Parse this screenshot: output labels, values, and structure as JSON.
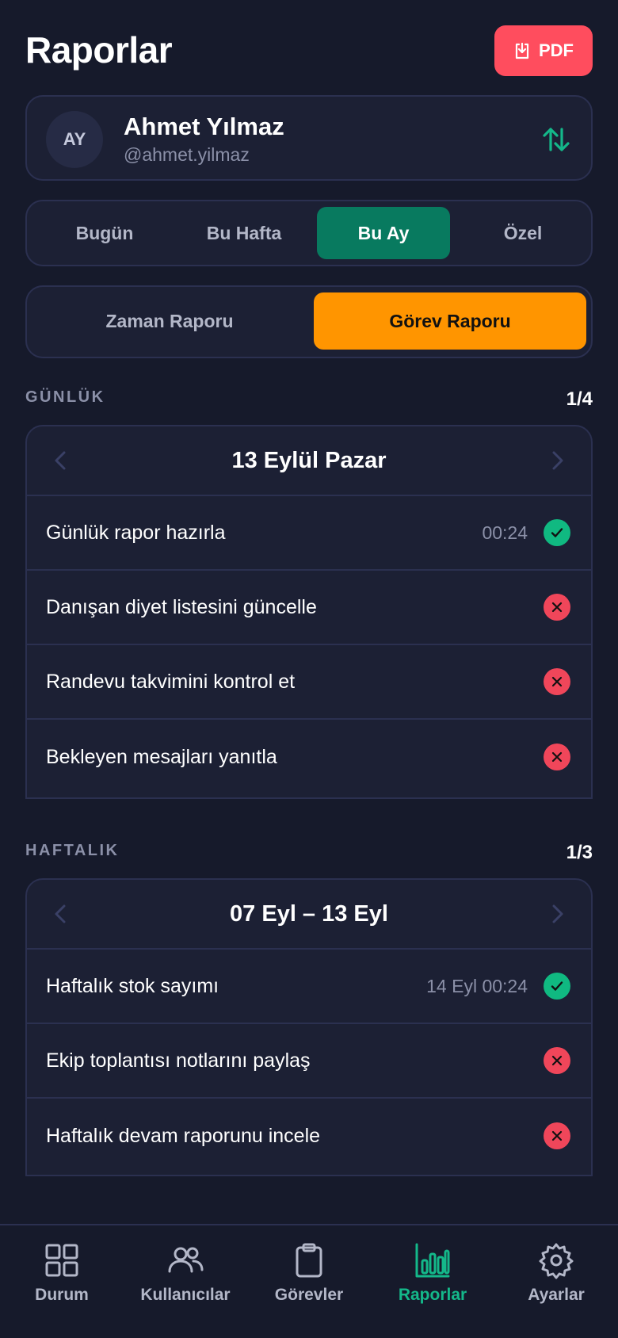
{
  "header": {
    "title": "Raporlar",
    "pdf_label": "PDF"
  },
  "user": {
    "initials": "AY",
    "name": "Ahmet Yılmaz",
    "handle": "@ahmet.yilmaz"
  },
  "range_tabs": [
    {
      "label": "Bugün",
      "active": false
    },
    {
      "label": "Bu Hafta",
      "active": false
    },
    {
      "label": "Bu Ay",
      "active": true
    },
    {
      "label": "Özel",
      "active": false
    }
  ],
  "report_tabs": [
    {
      "label": "Zaman Raporu",
      "active": false
    },
    {
      "label": "Görev Raporu",
      "active": true
    }
  ],
  "daily": {
    "label": "GÜNLÜK",
    "count": "1/4",
    "date": "13 Eylül Pazar",
    "tasks": [
      {
        "title": "Günlük rapor hazırla",
        "time": "00:24",
        "status": "done"
      },
      {
        "title": "Danışan diyet listesini güncelle",
        "time": "",
        "status": "fail"
      },
      {
        "title": "Randevu takvimini kontrol et",
        "time": "",
        "status": "fail"
      },
      {
        "title": "Bekleyen mesajları yanıtla",
        "time": "",
        "status": "fail"
      }
    ]
  },
  "weekly": {
    "label": "HAFTALIK",
    "count": "1/3",
    "date": "07 Eyl – 13 Eyl",
    "tasks": [
      {
        "title": "Haftalık stok sayımı",
        "time": "14 Eyl 00:24",
        "status": "done"
      },
      {
        "title": "Ekip toplantısı notlarını paylaş",
        "time": "",
        "status": "fail"
      },
      {
        "title": "Haftalık devam raporunu incele",
        "time": "",
        "status": "fail"
      }
    ]
  },
  "nav": [
    {
      "label": "Durum",
      "icon": "grid-icon",
      "active": false
    },
    {
      "label": "Kullanıcılar",
      "icon": "users-icon",
      "active": false
    },
    {
      "label": "Görevler",
      "icon": "clipboard-icon",
      "active": false
    },
    {
      "label": "Raporlar",
      "icon": "bar-chart-icon",
      "active": true
    },
    {
      "label": "Ayarlar",
      "icon": "gear-icon",
      "active": false
    }
  ],
  "colors": {
    "background": "#161a2b",
    "accent_green": "#087a5f",
    "accent_orange": "#ff9500",
    "danger": "#f0465a",
    "success": "#10b981"
  }
}
